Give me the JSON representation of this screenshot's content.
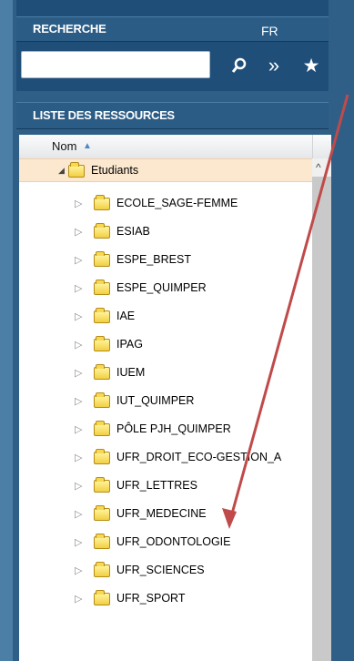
{
  "colors": {
    "background": "#2f5f86",
    "panel_header": "#2b5c86",
    "selected_row": "#fbe8cf",
    "folder": "#f2cf43",
    "annotation_arrow": "#c04a4a"
  },
  "header": {
    "title": "RECHERCHE",
    "language": "FR"
  },
  "search": {
    "value": "",
    "placeholder": "",
    "icons": [
      "search-icon",
      "forward-icon",
      "favorite-icon"
    ]
  },
  "resource_list": {
    "title": "LISTE DES RESSOURCES",
    "column": "Nom",
    "sort": "ascending",
    "root": {
      "label": "Etudiants",
      "expanded": true,
      "selected": true
    },
    "items": [
      {
        "label": "ECOLE_SAGE-FEMME"
      },
      {
        "label": "ESIAB"
      },
      {
        "label": "ESPE_BREST"
      },
      {
        "label": "ESPE_QUIMPER"
      },
      {
        "label": "IAE"
      },
      {
        "label": "IPAG"
      },
      {
        "label": "IUEM"
      },
      {
        "label": "IUT_QUIMPER"
      },
      {
        "label": "PÔLE PJH_QUIMPER"
      },
      {
        "label": "UFR_DROIT_ECO-GESTION_A"
      },
      {
        "label": "UFR_LETTRES"
      },
      {
        "label": "UFR_MEDECINE"
      },
      {
        "label": "UFR_ODONTOLOGIE"
      },
      {
        "label": "UFR_SCIENCES"
      },
      {
        "label": "UFR_SPORT"
      }
    ]
  }
}
